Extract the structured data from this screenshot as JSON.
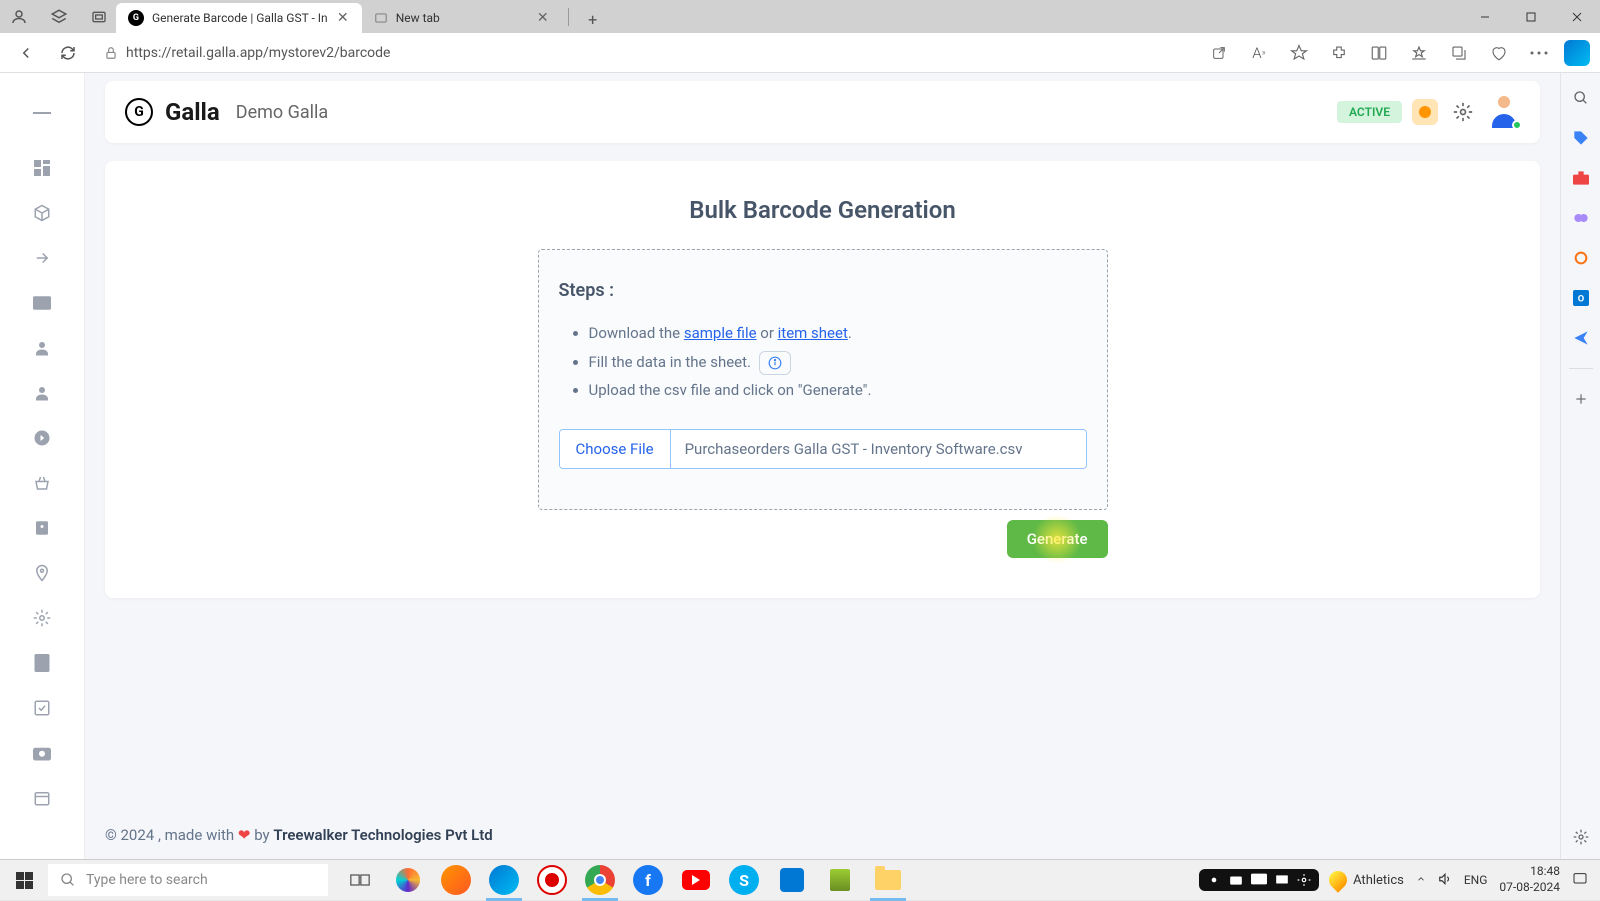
{
  "browser": {
    "tabs": [
      {
        "title": "Generate Barcode | Galla GST - In",
        "active": true
      },
      {
        "title": "New tab",
        "active": false
      }
    ],
    "url": "https://retail.galla.app/mystorev2/barcode"
  },
  "header": {
    "logo_text": "Galla",
    "store_name": "Demo Galla",
    "status": "ACTIVE"
  },
  "page": {
    "title": "Bulk Barcode Generation",
    "steps_heading": "Steps :",
    "step1_prefix": "Download the ",
    "step1_link1": "sample file",
    "step1_or": " or ",
    "step1_link2": "item sheet",
    "step1_suffix": ".",
    "step2": "Fill the data in the sheet.",
    "step3": "Upload the csv file and click on \"Generate\".",
    "choose_file_label": "Choose File",
    "file_name": "Purchaseorders  Galla GST - Inventory Software.csv",
    "generate_label": "Generate"
  },
  "footer": {
    "prefix": "© 2024 , made with ",
    "by": " by ",
    "company": "Treewalker Technologies Pvt Ltd"
  },
  "taskbar": {
    "search_placeholder": "Type here to search",
    "weather_label": "Athletics",
    "lang": "ENG",
    "time": "18:48",
    "date": "07-08-2024"
  }
}
